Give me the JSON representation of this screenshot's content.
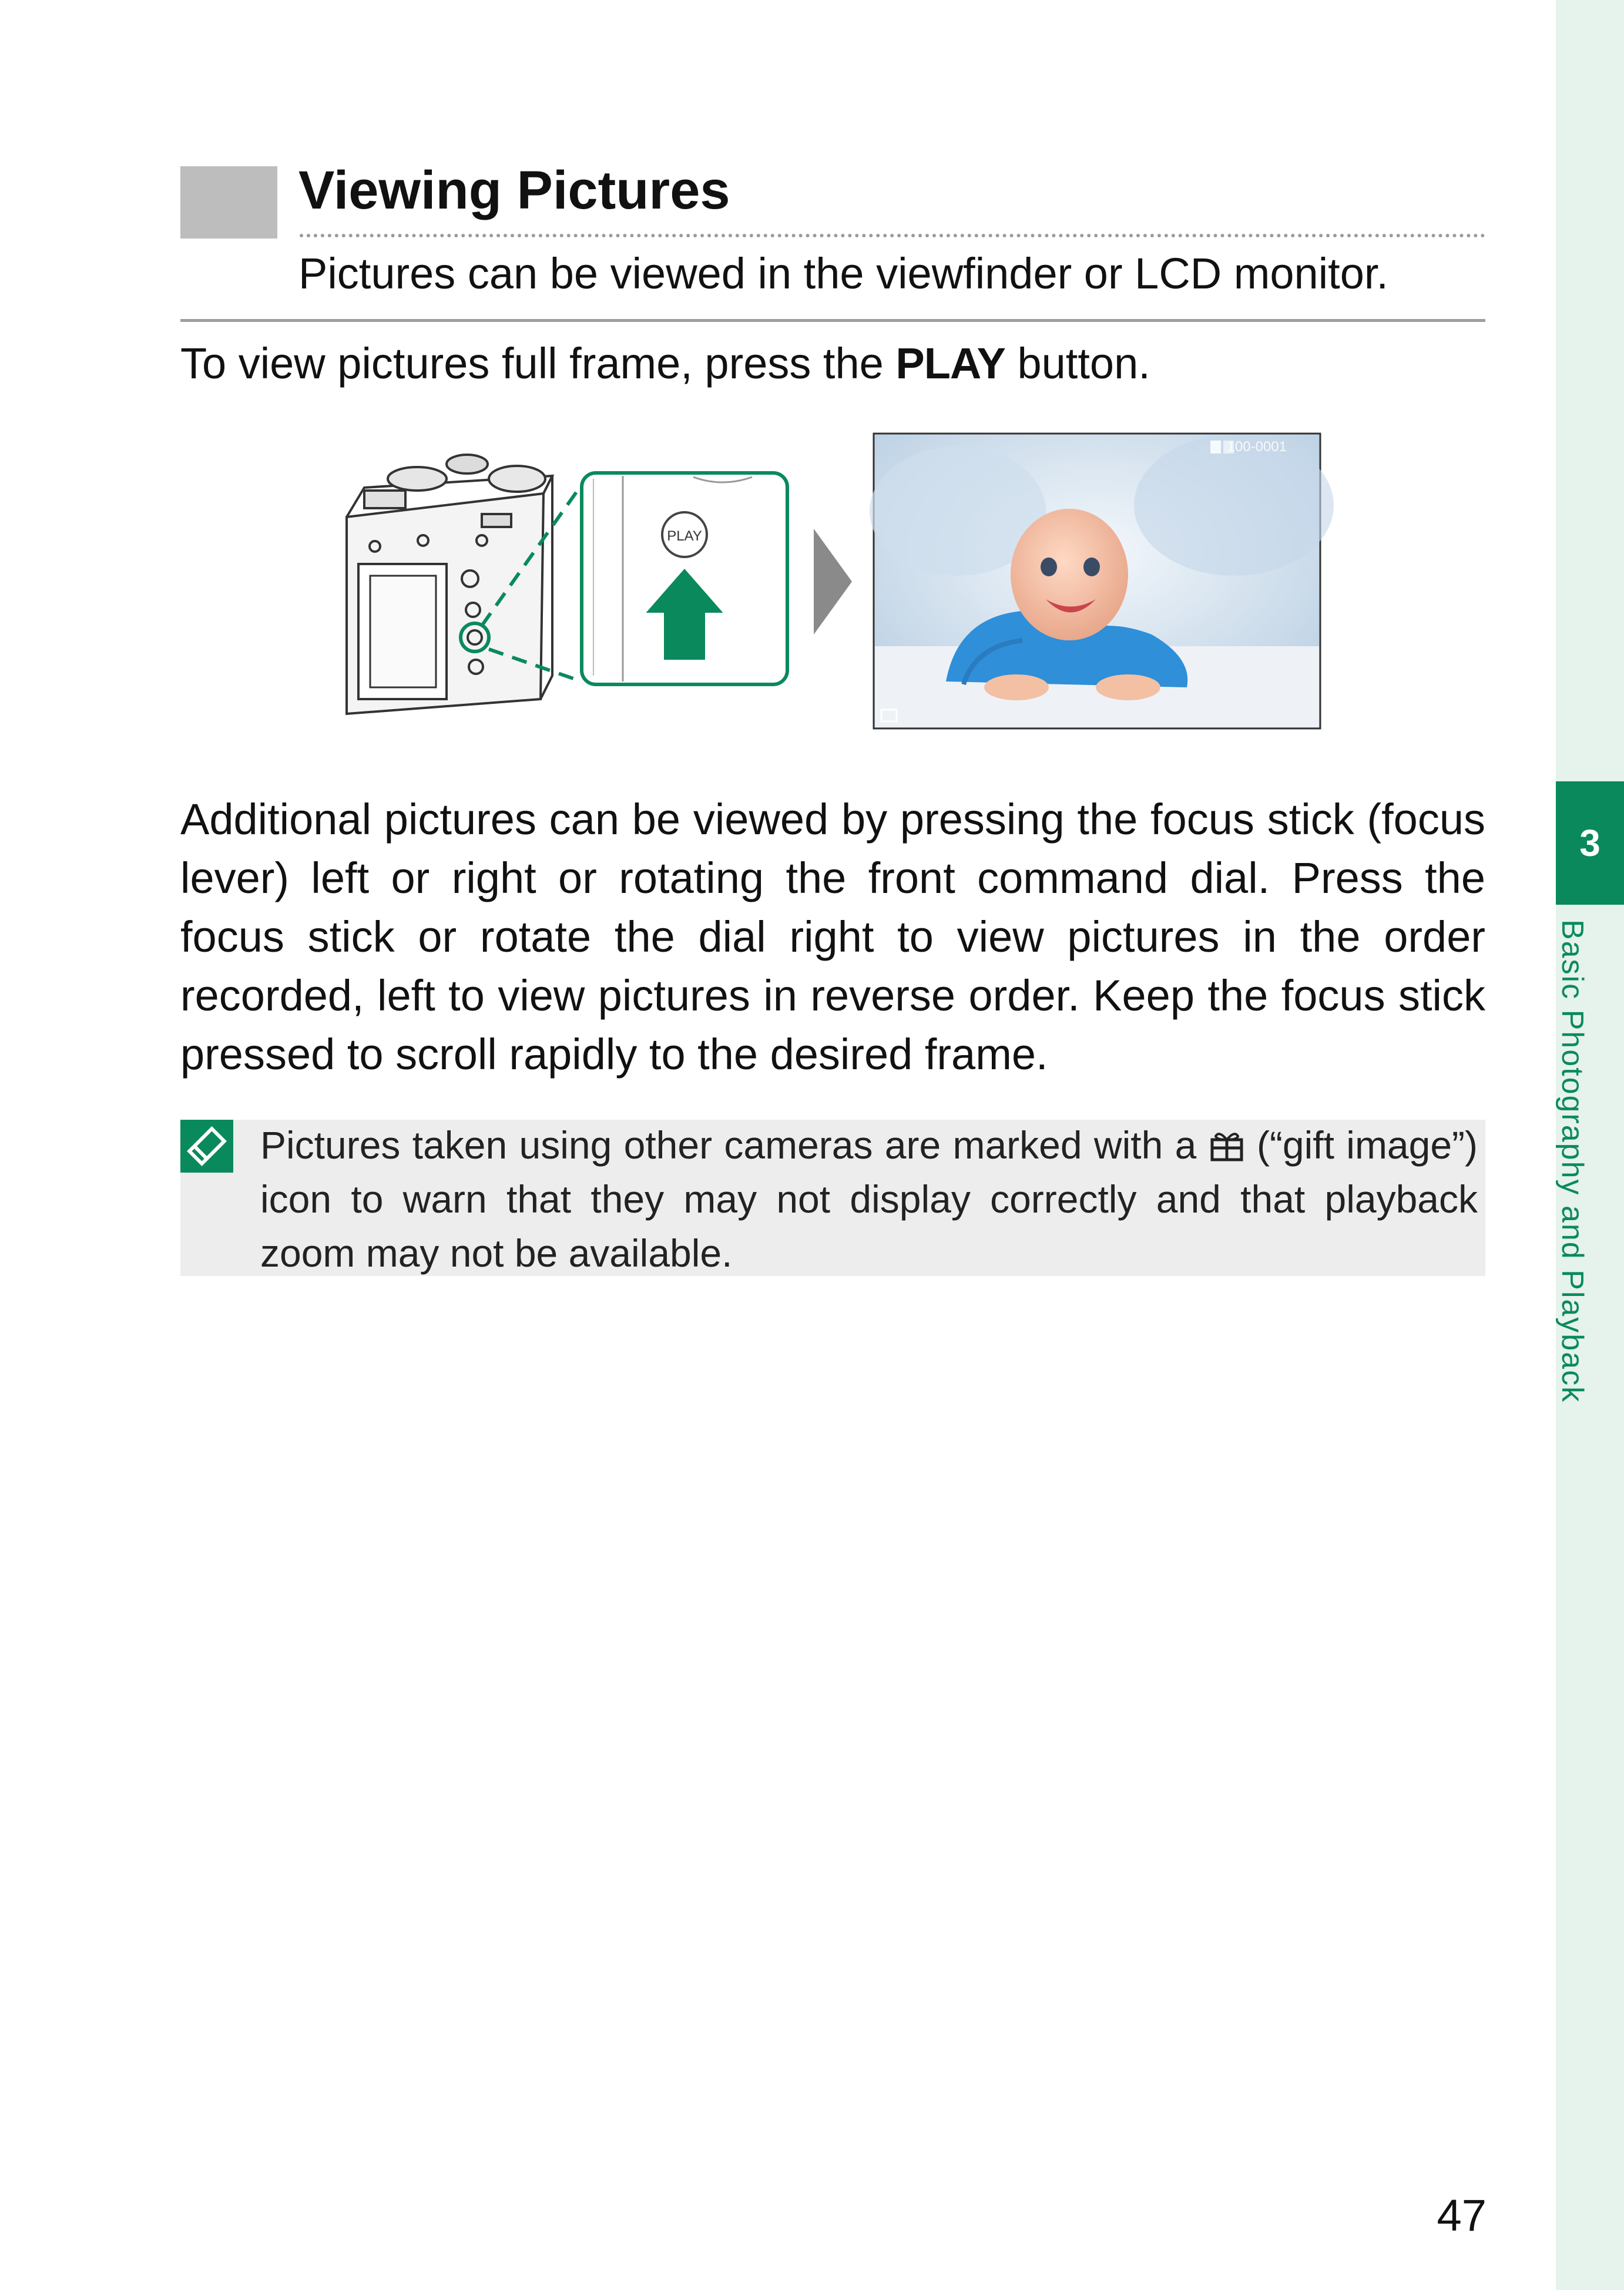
{
  "chapter": {
    "number": "3",
    "title": "Basic Photography and Playback"
  },
  "heading": {
    "title": "Viewing Pictures",
    "subtitle": "Pictures can be viewed in the viewfinder or LCD monitor."
  },
  "intro": {
    "before": "To view pictures full frame, press the ",
    "button": "PLAY",
    "after": " button."
  },
  "illustration": {
    "button_label": "PLAY",
    "frame_number": "100-0001"
  },
  "body": "Additional pictures can be viewed by pressing the focus stick (focus lever) left or right or rotating the front command dial.  Press the focus stick or rotate the dial right to view pictures in the order recorded, left to view pictures in reverse order.  Keep the focus stick pressed to scroll rapidly to the desired frame.",
  "note": {
    "before": "Pictures taken using other cameras are marked with a ",
    "after": " (“gift image”) icon to warn that they may not display correctly and that playback zoom may not be available.",
    "icon": "gift-icon"
  },
  "page_number": "47",
  "colors": {
    "accent": "#0a8a5c",
    "tab_background": "#e6f2ec",
    "note_background": "#ededed"
  }
}
